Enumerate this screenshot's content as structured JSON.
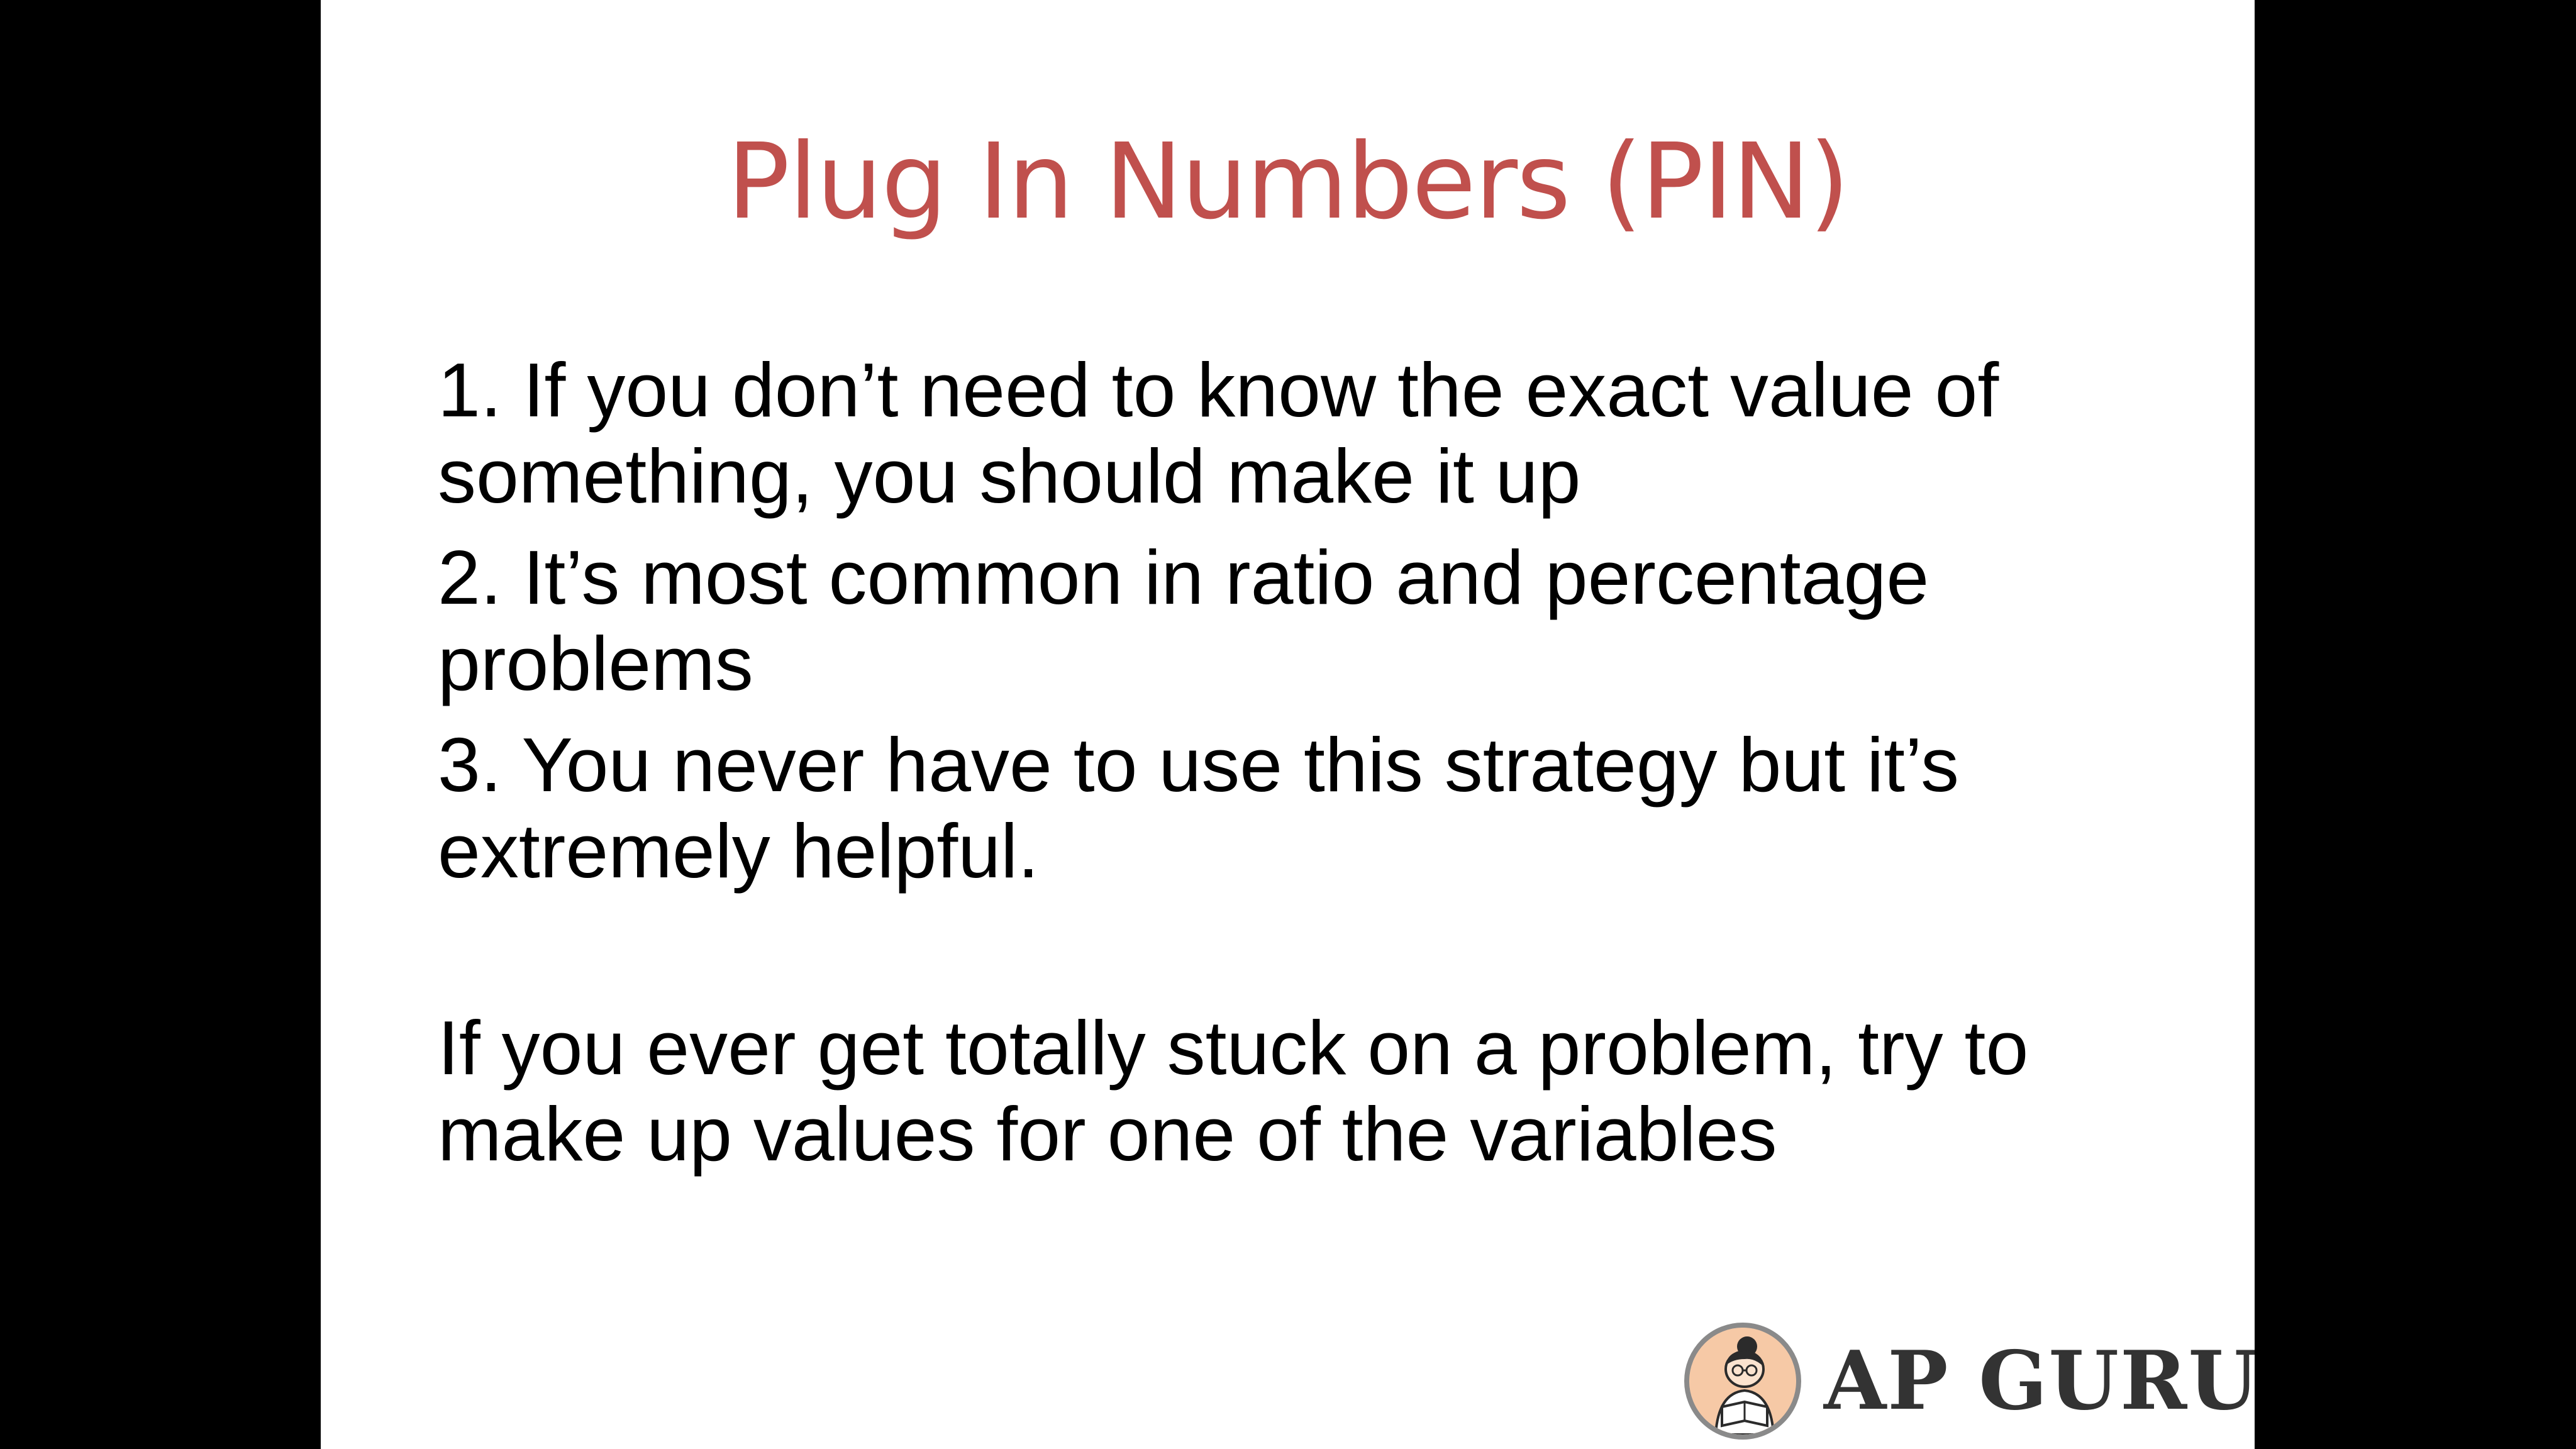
{
  "slide": {
    "title": "Plug In Numbers (PIN)",
    "points": [
      "1. If you don’t need to know the exact value of something, you should make it up",
      "2. It’s most common in ratio and percentage problems",
      "3. You never have to use this strategy but it’s extremely helpful."
    ],
    "closing": "If you ever get totally stuck on a problem, try to make up values for one of the variables"
  },
  "logo": {
    "text": "AP GURU",
    "icon": "tutor-reading-book-icon"
  },
  "colors": {
    "title": "#c0504d",
    "body_text": "#000000",
    "slide_background": "#ffffff",
    "letterbox": "#000000",
    "logo_text": "#333333"
  }
}
